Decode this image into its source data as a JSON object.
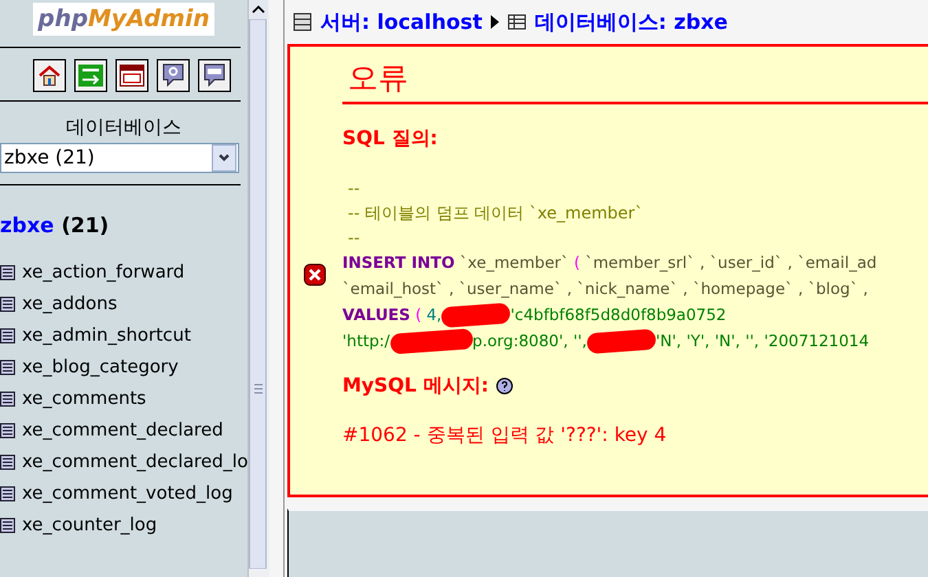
{
  "logo": {
    "php": "php",
    "rest": "MyAdmin"
  },
  "toolbar": [
    {
      "kind": "home"
    },
    {
      "kind": "exit"
    },
    {
      "kind": "sql"
    },
    {
      "kind": "help"
    },
    {
      "kind": "query"
    }
  ],
  "database_label": "데이터베이스",
  "database_select": {
    "value": "zbxe (21)"
  },
  "database_heading": {
    "name": "zbxe",
    "count": "(21)"
  },
  "tables": [
    "xe_action_forward",
    "xe_addons",
    "xe_admin_shortcut",
    "xe_blog_category",
    "xe_comments",
    "xe_comment_declared",
    "xe_comment_declared_lo",
    "xe_comment_voted_log",
    "xe_counter_log"
  ],
  "breadcrumb": [
    {
      "kind": "server",
      "text": "서버: localhost"
    },
    {
      "kind": "database",
      "text": "데이터베이스: zbxe"
    }
  ],
  "error": {
    "title": "오류",
    "sql_label": "SQL 질의:",
    "comment_lines": [
      "--",
      "-- 테이블의 덤프 데이터 `xe_member`",
      "--"
    ],
    "sql_lines": [
      [
        {
          "kind": "keyword",
          "text": "INSERT INTO"
        },
        {
          "kind": "ident",
          "text": " `xe_member` "
        },
        {
          "kind": "punct",
          "text": "("
        },
        {
          "kind": "ident",
          "text": " `member_srl` , `user_id` , `email_ad"
        }
      ],
      [
        {
          "kind": "ident",
          "text": "`email_host` , `user_name` , `nick_name` , `homepage` , `blog` ,"
        }
      ],
      [
        {
          "kind": "keyword",
          "text": "VALUES"
        },
        {
          "kind": "punct",
          "text": " ("
        },
        {
          "kind": "number",
          "text": " 4,"
        },
        {
          "kind": "redacted"
        },
        {
          "kind": "string",
          "text": "'c4bfbf68f5d8d0f8b9a0752"
        }
      ],
      [
        {
          "kind": "string",
          "text": "'http:/"
        },
        {
          "kind": "redacted"
        },
        {
          "kind": "string",
          "text": "p.org:8080', '',"
        },
        {
          "kind": "redacted"
        },
        {
          "kind": "string",
          "text": "'N', 'Y', 'N', '', '2007121014"
        }
      ]
    ],
    "mysql_label": "MySQL 메시지:",
    "message": "#1062 - 중복된 입력 값 '???': key 4"
  }
}
